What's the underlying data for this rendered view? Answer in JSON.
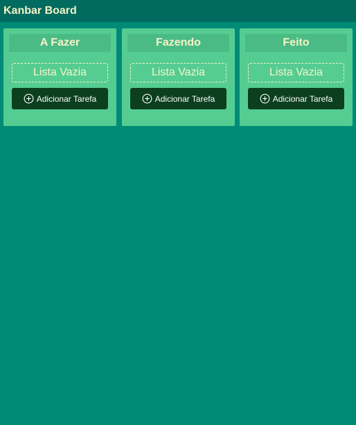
{
  "app": {
    "title": "Kanbar Board"
  },
  "columns": [
    {
      "title": "A Fazer",
      "empty_text": "Lista Vazia",
      "add_label": "Adicionar Tarefa"
    },
    {
      "title": "Fazendo",
      "empty_text": "Lista Vazia",
      "add_label": "Adicionar Tarefa"
    },
    {
      "title": "Feito",
      "empty_text": "Lista Vazia",
      "add_label": "Adicionar Tarefa"
    }
  ],
  "icons": {
    "add": "plus-circle-icon"
  },
  "colors": {
    "background": "#008b77",
    "header": "#006b5e",
    "column": "#55cd92",
    "column_title_bg": "#4bbb85",
    "button": "#0b3f1e",
    "text_light": "#f6f3c8"
  }
}
